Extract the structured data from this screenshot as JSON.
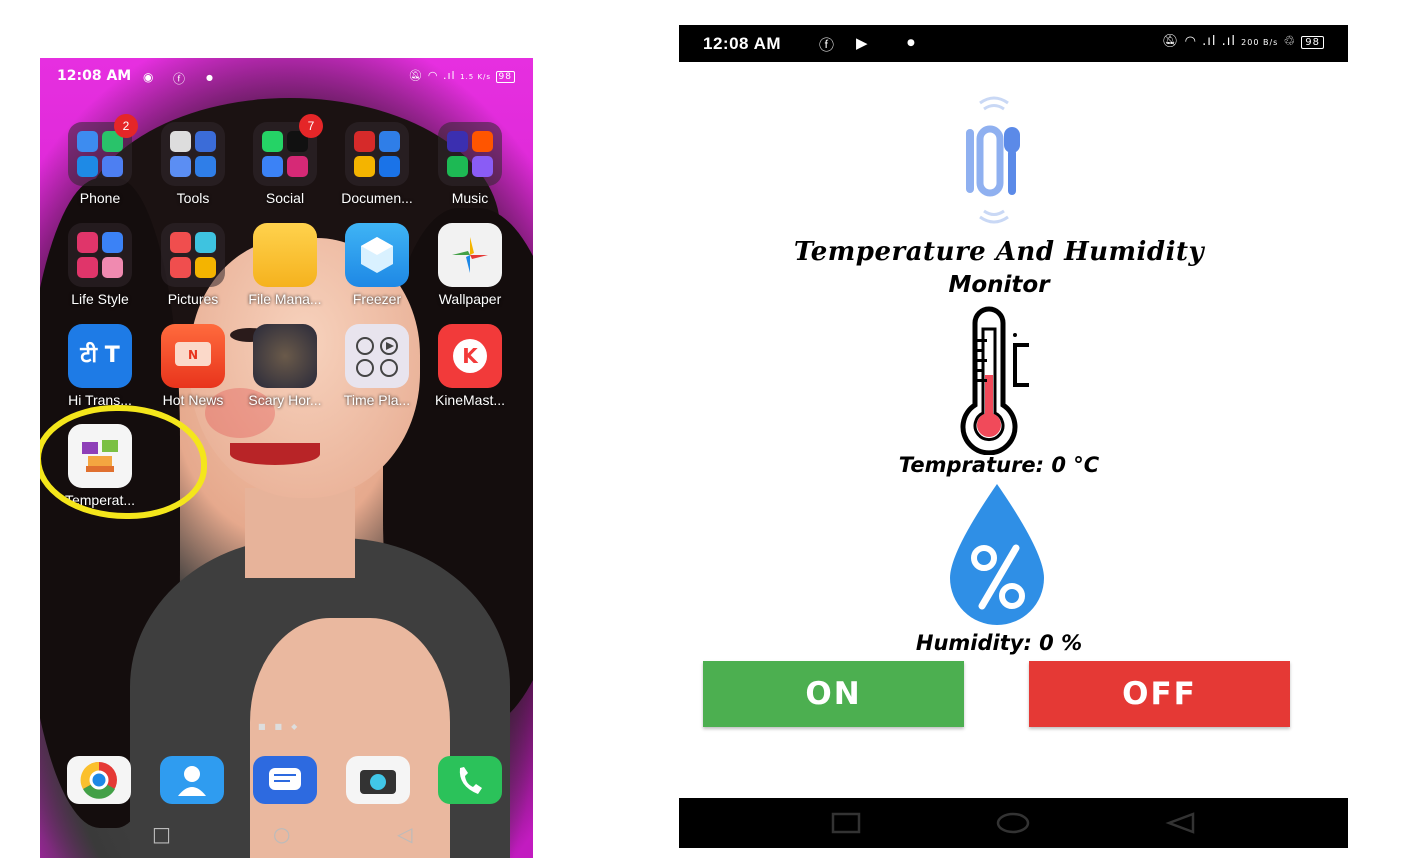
{
  "left_phone": {
    "status_bar": {
      "time": "12:08 AM",
      "right": "1.5 K/s",
      "battery": "98"
    },
    "apps": [
      {
        "label": "Phone",
        "badge": "2"
      },
      {
        "label": "Tools",
        "badge": ""
      },
      {
        "label": "Social",
        "badge": "7"
      },
      {
        "label": "Documen...",
        "badge": ""
      },
      {
        "label": "Music",
        "badge": ""
      },
      {
        "label": "Life Style"
      },
      {
        "label": "Pictures"
      },
      {
        "label": "File Mana..."
      },
      {
        "label": "Freezer"
      },
      {
        "label": "Wallpaper"
      },
      {
        "label": "Hi Trans..."
      },
      {
        "label": "Hot News"
      },
      {
        "label": "Scary Hor..."
      },
      {
        "label": "Time Pla..."
      },
      {
        "label": "KineMast..."
      },
      {
        "label": "Temperat..."
      }
    ],
    "dock": [
      "chrome-icon",
      "contacts-icon",
      "messages-icon",
      "camera-icon",
      "phone-dialer-icon"
    ]
  },
  "right_phone": {
    "status_bar": {
      "time": "12:08 AM",
      "speed": "200 B/s",
      "battery": "98"
    },
    "logo_icon": "iot-icon",
    "title": "Temperature And Humidity",
    "subtitle": "Monitor",
    "temperature_label": "Temprature: 0 °C",
    "humidity_label": "Humidity: 0 %",
    "on_button": "ON",
    "off_button": "OFF",
    "colors": {
      "on": "#4caf50",
      "off": "#e53935",
      "drop": "#2f8fe6",
      "thermo_fill": "#f14a5a"
    }
  }
}
